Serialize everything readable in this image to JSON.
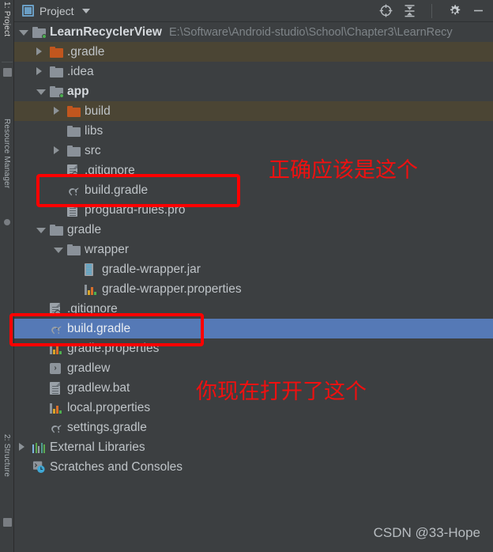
{
  "window": {
    "title": "Project",
    "project_icon": "project-window-icon",
    "dropdown_icon": "chevron-down-icon",
    "actions": [
      {
        "name": "select-opened-file-icon",
        "label": "Select Opened File"
      },
      {
        "name": "collapse-all-icon",
        "label": "Collapse All"
      },
      {
        "name": "settings-gear-icon",
        "label": "Settings"
      },
      {
        "name": "hide-minimize-icon",
        "label": "Hide"
      }
    ]
  },
  "left_strip": {
    "tabs": [
      {
        "label": "1: Project",
        "active": true
      },
      {
        "label": "Resource Manager",
        "active": false
      },
      {
        "label": "2: Structure",
        "active": false
      }
    ]
  },
  "tree": {
    "rows": [
      {
        "label": "LearnRecyclerView",
        "path": "E:\\Software\\Android-studio\\School\\Chapter3\\LearnRecy",
        "indent": 0,
        "arrow": "open",
        "icon": "module-folder-icon",
        "bold": true,
        "state": "normal"
      },
      {
        "label": ".gradle",
        "indent": 1,
        "arrow": "closed",
        "icon": "folder-excluded-icon",
        "bold": false,
        "state": "excluded"
      },
      {
        "label": ".idea",
        "indent": 1,
        "arrow": "closed",
        "icon": "folder-icon",
        "bold": false,
        "state": "normal"
      },
      {
        "label": "app",
        "indent": 1,
        "arrow": "open",
        "icon": "module-folder-icon",
        "bold": true,
        "state": "normal"
      },
      {
        "label": "build",
        "indent": 2,
        "arrow": "closed",
        "icon": "folder-excluded-icon",
        "bold": false,
        "state": "excluded"
      },
      {
        "label": "libs",
        "indent": 2,
        "arrow": "none",
        "icon": "folder-icon",
        "bold": false,
        "state": "normal"
      },
      {
        "label": "src",
        "indent": 2,
        "arrow": "closed",
        "icon": "folder-icon",
        "bold": false,
        "state": "normal"
      },
      {
        "label": ".gitignore",
        "indent": 2,
        "arrow": "none",
        "icon": "gitignore-file-icon",
        "bold": false,
        "state": "normal"
      },
      {
        "label": "build.gradle",
        "indent": 2,
        "arrow": "none",
        "icon": "gradle-file-icon",
        "bold": false,
        "state": "normal"
      },
      {
        "label": "proguard-rules.pro",
        "indent": 2,
        "arrow": "none",
        "icon": "text-file-icon",
        "bold": false,
        "state": "normal"
      },
      {
        "label": "gradle",
        "indent": 1,
        "arrow": "open",
        "icon": "folder-icon",
        "bold": false,
        "state": "normal"
      },
      {
        "label": "wrapper",
        "indent": 2,
        "arrow": "open",
        "icon": "folder-icon",
        "bold": false,
        "state": "normal"
      },
      {
        "label": "gradle-wrapper.jar",
        "indent": 3,
        "arrow": "none",
        "icon": "jar-file-icon",
        "bold": false,
        "state": "normal"
      },
      {
        "label": "gradle-wrapper.properties",
        "indent": 3,
        "arrow": "none",
        "icon": "properties-file-icon",
        "bold": false,
        "state": "normal"
      },
      {
        "label": ".gitignore",
        "indent": 1,
        "arrow": "none",
        "icon": "gitignore-file-icon",
        "bold": false,
        "state": "normal"
      },
      {
        "label": "build.gradle",
        "indent": 1,
        "arrow": "none",
        "icon": "gradle-file-icon",
        "bold": false,
        "state": "selected"
      },
      {
        "label": "gradle.properties",
        "indent": 1,
        "arrow": "none",
        "icon": "properties-file-icon",
        "bold": false,
        "state": "normal"
      },
      {
        "label": "gradlew",
        "indent": 1,
        "arrow": "none",
        "icon": "shell-script-file-icon",
        "bold": false,
        "state": "normal"
      },
      {
        "label": "gradlew.bat",
        "indent": 1,
        "arrow": "none",
        "icon": "text-file-icon",
        "bold": false,
        "state": "normal"
      },
      {
        "label": "local.properties",
        "indent": 1,
        "arrow": "none",
        "icon": "properties-file-icon",
        "bold": false,
        "state": "normal"
      },
      {
        "label": "settings.gradle",
        "indent": 1,
        "arrow": "none",
        "icon": "gradle-file-icon",
        "bold": false,
        "state": "normal"
      },
      {
        "label": "External Libraries",
        "indent": 0,
        "arrow": "closed",
        "icon": "external-libraries-icon",
        "bold": false,
        "state": "normal"
      },
      {
        "label": "Scratches and Consoles",
        "indent": 0,
        "arrow": "none",
        "icon": "scratches-icon",
        "bold": false,
        "state": "normal"
      }
    ]
  },
  "annotations": {
    "color": "#ff0000",
    "texts": [
      {
        "name": "annotation-correct-one",
        "text": "正确应该是这个"
      },
      {
        "name": "annotation-currently-open",
        "text": "你现在打开了这个"
      }
    ],
    "rect_labels": [
      {
        "name": "annotation-rect-app-build-gradle"
      },
      {
        "name": "annotation-rect-project-build-gradle"
      }
    ]
  },
  "watermark": {
    "text": "CSDN @33-Hope"
  }
}
